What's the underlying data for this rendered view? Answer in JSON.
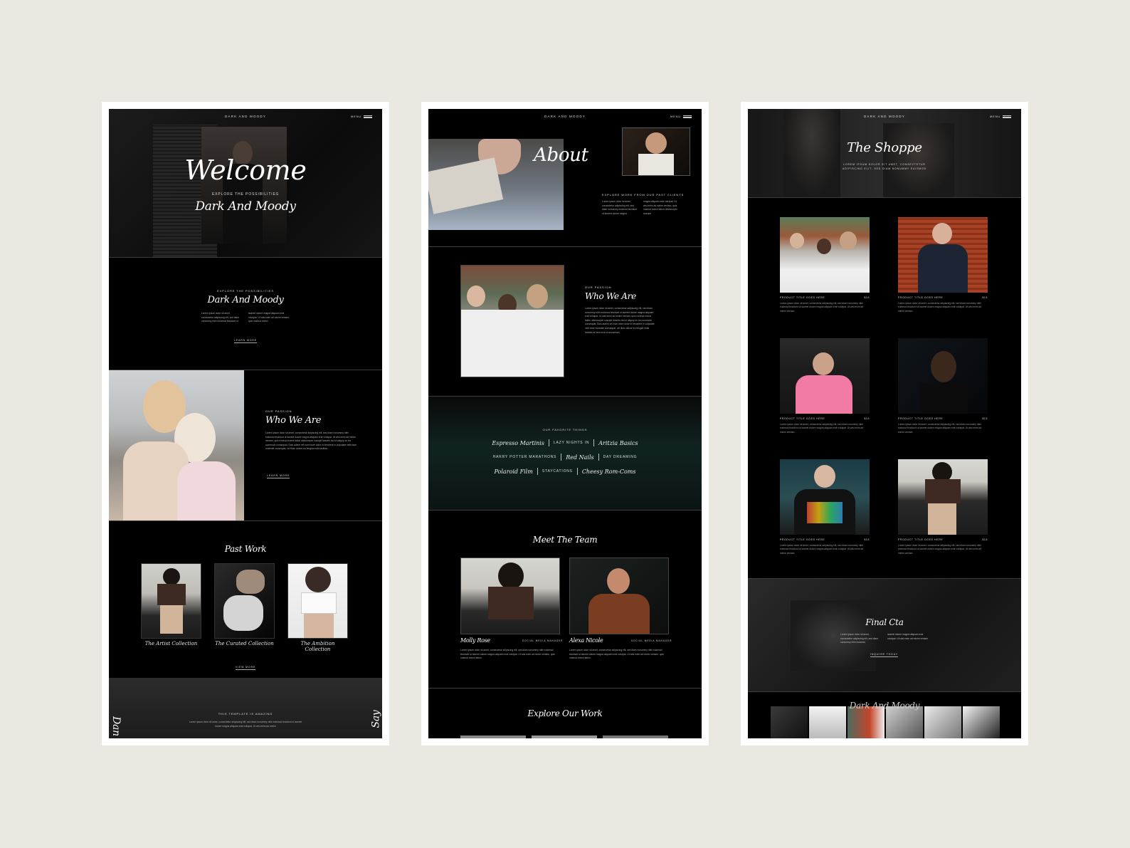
{
  "site": {
    "brand": "DARK AND MOODY",
    "menu": "MENU"
  },
  "home": {
    "hero": {
      "title": "Welcome",
      "kicker": "EXPLORE THE POSSIBILITIES",
      "subtitle": "Dark And Moody"
    },
    "intro": {
      "kicker": "EXPLORE THE POSSIBILITIES",
      "heading": "Dark And Moody",
      "body_left": "Lorem ipsum dolor sit amet, consectetur adipiscing elit, sed diam nonummy nibh euismod tincidunt ut",
      "body_right": "laoreet dolore magna aliquam erat volutpat. Ut wisi enim ad minim veniam, quis nostrud exerci",
      "button": "LEARN MORE"
    },
    "passion": {
      "kicker": "OUR PASSION",
      "heading": "Who We Are",
      "body": "Lorem ipsum dolor sit amet, consectetur adipiscing elit, sed diam nonummy nibh euismod tincidunt ut laoreet dolore magna aliquam erat volutpat. Ut wisi enim ad minim veniam, quis nostrud exerci tation ullamcorper suscipit lobortis nisl ut aliquip ex ea commodo consequat. Duis autem vel eum iriure dolor in hendrerit in vulputate velit esse molestie consequat, vel illum dolore eu feugiat nulla facilisis.",
      "button": "LEARN MORE"
    },
    "past_work": {
      "heading": "Past Work",
      "items": [
        "The Artist Collection",
        "The Curated Collection",
        "The Ambition Collection"
      ],
      "button": "VIEW MORE"
    },
    "footer": {
      "kicker": "THIS TEMPLATE IS AMAZING",
      "body": "Lorem ipsum dolor sit amet, consectetur adipiscing elit, sed diam nonummy nibh euismod tincidunt ut laoreet dolore magna aliquam erat volutpat. Ut wisi enim ad minim",
      "side_left": "Dan",
      "side_right": "Say"
    }
  },
  "about": {
    "hero": {
      "title": "About",
      "kicker": "EXPLORE WORK FROM OUR PAST CLIENTS",
      "body_left": "Lorem ipsum dolor sit amet, consectetur adipiscing elit, sed diam nonummy euismod tincidunt ut laoreet dolore magna",
      "body_right": "magna aliquam erat volutpat. Ut wisi enim ad minim veniam, quis nostrud exerci tation ullamcorper suscipit"
    },
    "who": {
      "kicker": "OUR PASSION",
      "heading": "Who We Are",
      "body": "Lorem ipsum dolor sit amet, consectetur adipiscing elit, sed diam nonummy nibh euismod tincidunt ut laoreet dolore magna aliquam erat volutpat. Ut wisi enim ad minim veniam, quis nostrud exerci tation ullamcorper suscipit lobortis nisl ut aliquip ex ea commodo consequat. Duis autem vel eum iriure dolor in hendrerit in vulputate velit esse molestie consequat, vel illum dolore eu feugiat nulla facilisis at vero eros et accumsan."
    },
    "favorites": {
      "kicker": "OUR FAVORITE THINGS",
      "rows": [
        [
          {
            "text": "Espresso Martinis",
            "style": "script"
          },
          {
            "text": "LAZY NIGHTS IN",
            "style": "caps"
          },
          {
            "text": "Aritzia Basics",
            "style": "script"
          }
        ],
        [
          {
            "text": "HARRY POTTER MARATHONS",
            "style": "caps"
          },
          {
            "text": "Red Nails",
            "style": "script"
          },
          {
            "text": "DAY DREAMING",
            "style": "caps"
          }
        ],
        [
          {
            "text": "Polaroid Film",
            "style": "script"
          },
          {
            "text": "STAYCATIONS",
            "style": "caps"
          },
          {
            "text": "Cheesy Rom-Coms",
            "style": "script"
          }
        ]
      ]
    },
    "team": {
      "heading": "Meet The Team",
      "members": [
        {
          "name": "Molly Rose",
          "role": "SOCIAL MEDIA MANAGER",
          "bio": "Lorem ipsum dolor sit amet, consectetur adipiscing elit, sed diam nonummy nibh euismod tincidunt ut laoreet dolore magna aliquam erat volutpat. Ut wisi enim ad minim veniam, quis nostrud exerci tation."
        },
        {
          "name": "Alexa Nicole",
          "role": "SOCIAL MEDIA MANAGER",
          "bio": "Lorem ipsum dolor sit amet, consectetur adipiscing elit, sed diam nonummy nibh euismod tincidunt ut laoreet dolore magna aliquam erat volutpat. Ut wisi enim ad minim veniam, quis nostrud exerci tation."
        }
      ]
    },
    "explore": {
      "heading": "Explore Our Work"
    }
  },
  "shop": {
    "hero": {
      "title": "The Shoppe",
      "line1": "LOREM IPSUM DOLOR SIT AMET, CONSECTETUR",
      "line2": "ADIPISCING ELIT, SED DIAM NONUMMY EUISMOD"
    },
    "products": [
      {
        "title": "PRODUCT TITLE GOES HERE",
        "price": "$15",
        "desc": "Lorem ipsum dolor sit amet, consectetur adipiscing elit, sed diam nonummy nibh euismod tincidunt ut laoreet dolore magna aliquam erat volutpat. Ut wisi enim ad minim veniam."
      },
      {
        "title": "PRODUCT TITLE GOES HERE",
        "price": "$15",
        "desc": "Lorem ipsum dolor sit amet, consectetur adipiscing elit, sed diam nonummy nibh euismod tincidunt ut laoreet dolore magna aliquam erat volutpat. Ut wisi enim ad minim veniam."
      },
      {
        "title": "PRODUCT TITLE GOES HERE",
        "price": "$15",
        "desc": "Lorem ipsum dolor sit amet, consectetur adipiscing elit, sed diam nonummy nibh euismod tincidunt ut laoreet dolore magna aliquam erat volutpat. Ut wisi enim ad minim veniam."
      },
      {
        "title": "PRODUCT TITLE GOES HERE",
        "price": "$15",
        "desc": "Lorem ipsum dolor sit amet, consectetur adipiscing elit, sed diam nonummy nibh euismod tincidunt ut laoreet dolore magna aliquam erat volutpat. Ut wisi enim ad minim veniam."
      },
      {
        "title": "PRODUCT TITLE GOES HERE",
        "price": "$15",
        "desc": "Lorem ipsum dolor sit amet, consectetur adipiscing elit, sed diam nonummy nibh euismod tincidunt ut laoreet dolore magna aliquam erat volutpat. Ut wisi enim ad minim veniam."
      },
      {
        "title": "PRODUCT TITLE GOES HERE",
        "price": "$15",
        "desc": "Lorem ipsum dolor sit amet, consectetur adipiscing elit, sed diam nonummy nibh euismod tincidunt ut laoreet dolore magna aliquam erat volutpat. Ut wisi enim ad minim veniam."
      }
    ],
    "cta": {
      "heading": "Final Cta",
      "body_left": "Lorem ipsum dolor sit amet, consectetur adipiscing elit, sed diam nonummy nibh euismod",
      "body_right": "laoreet dolore magna aliquam erat volutpat. Ut wisi enim ad minim veniam",
      "button": "INQUIRE TODAY"
    },
    "footer": {
      "heading": "Dark And Moody"
    }
  }
}
